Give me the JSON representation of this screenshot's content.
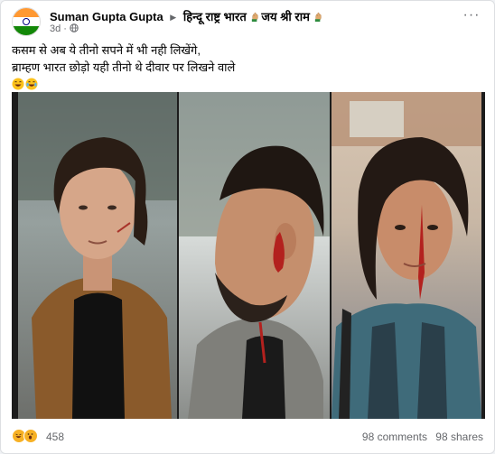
{
  "post": {
    "author": "Suman Gupta Gupta",
    "group": "हिन्दू राष्ट्र भारत",
    "group_suffix": "जय श्री राम",
    "time": "3d",
    "caption_line1": "कसम से अब ये तीनो सपने में भी नही लिखेंगे,",
    "caption_line2": "ब्राम्हण भारत छोड़ो यही तीनो थे दीवार पर लिखने वाले",
    "more_icon": "···"
  },
  "reactions": {
    "count": "458",
    "comments": "98 comments",
    "shares": "98 shares"
  },
  "colors": {
    "accent": "#1877f2",
    "secondary_text": "#65676b",
    "card_bg": "#ffffff"
  },
  "icons": [
    "india-flag-avatar-icon",
    "caret-right-icon",
    "raised-hand-icon",
    "globe-icon",
    "more-options-icon",
    "laughing-emoji-icon",
    "crying-laughing-emoji-icon",
    "haha-reaction-icon",
    "wow-reaction-icon"
  ]
}
